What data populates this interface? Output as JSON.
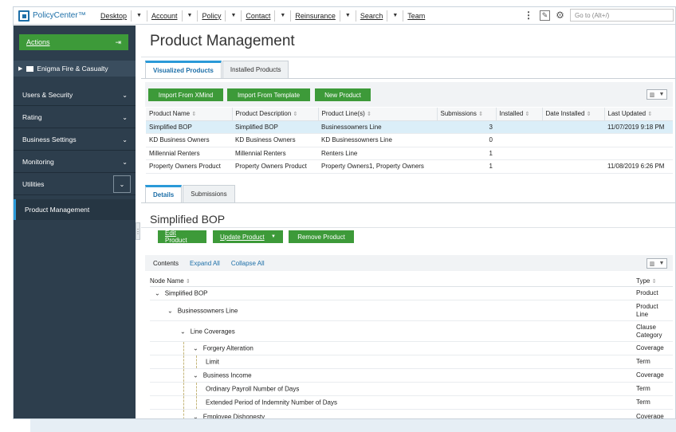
{
  "app": {
    "name": "PolicyCenter™"
  },
  "nav": {
    "items": [
      "Desktop",
      "Account",
      "Policy",
      "Contact",
      "Reinsurance",
      "Search",
      "Team"
    ],
    "goto_placeholder": "Go to (Alt+/)"
  },
  "sidebar": {
    "actions_label": "Actions",
    "org": "Enigma Fire & Casualty",
    "items": [
      "Users & Security",
      "Rating",
      "Business Settings",
      "Monitoring",
      "Utilities"
    ],
    "active": "Product Management"
  },
  "page": {
    "title": "Product Management"
  },
  "top_tabs": [
    "Visualized Products",
    "Installed Products"
  ],
  "toolbar": {
    "import_xmind": "Import From XMind",
    "import_template": "Import From Template",
    "new_product": "New Product"
  },
  "products": {
    "columns": [
      "Product Name",
      "Product Description",
      "Product Line(s)",
      "Submissions",
      "Installed",
      "Date Installed",
      "Last Updated"
    ],
    "rows": [
      [
        "Simplified BOP",
        "Simplified BOP",
        "Businessowners Line",
        "3",
        "",
        "",
        "11/07/2019 9:18 PM"
      ],
      [
        "KD Business Owners",
        "KD Business Owners",
        "KD Businessowners Line",
        "0",
        "",
        "",
        ""
      ],
      [
        "Millennial Renters",
        "Millennial Renters",
        "Renters Line",
        "1",
        "",
        "",
        ""
      ],
      [
        "Property Owners Product",
        "Property Owners Product",
        "Property Owners1, Property Owners",
        "1",
        "",
        "",
        "11/08/2019 6:26 PM"
      ]
    ]
  },
  "detail_tabs": [
    "Details",
    "Submissions"
  ],
  "detail": {
    "title": "Simplified BOP",
    "edit": "Edit Product",
    "update": "Update Product",
    "remove": "Remove Product",
    "contents": "Contents",
    "expand": "Expand All",
    "collapse": "Collapse All",
    "col_node": "Node Name",
    "col_type": "Type"
  },
  "tree": [
    {
      "name": "Simplified BOP",
      "type": "Product"
    },
    {
      "name": "Businessowners Line",
      "type": "Product Line"
    },
    {
      "name": "Line Coverages",
      "type": "Clause Category"
    },
    {
      "name": "Forgery Alteration",
      "type": "Coverage"
    },
    {
      "name": "Limit",
      "type": "Term"
    },
    {
      "name": "Business Income",
      "type": "Coverage"
    },
    {
      "name": "Ordinary Payroll Number of Days",
      "type": "Term"
    },
    {
      "name": "Extended Period of Indemnity Number of Days",
      "type": "Term"
    },
    {
      "name": "Employee Dishonesty",
      "type": "Coverage"
    }
  ]
}
